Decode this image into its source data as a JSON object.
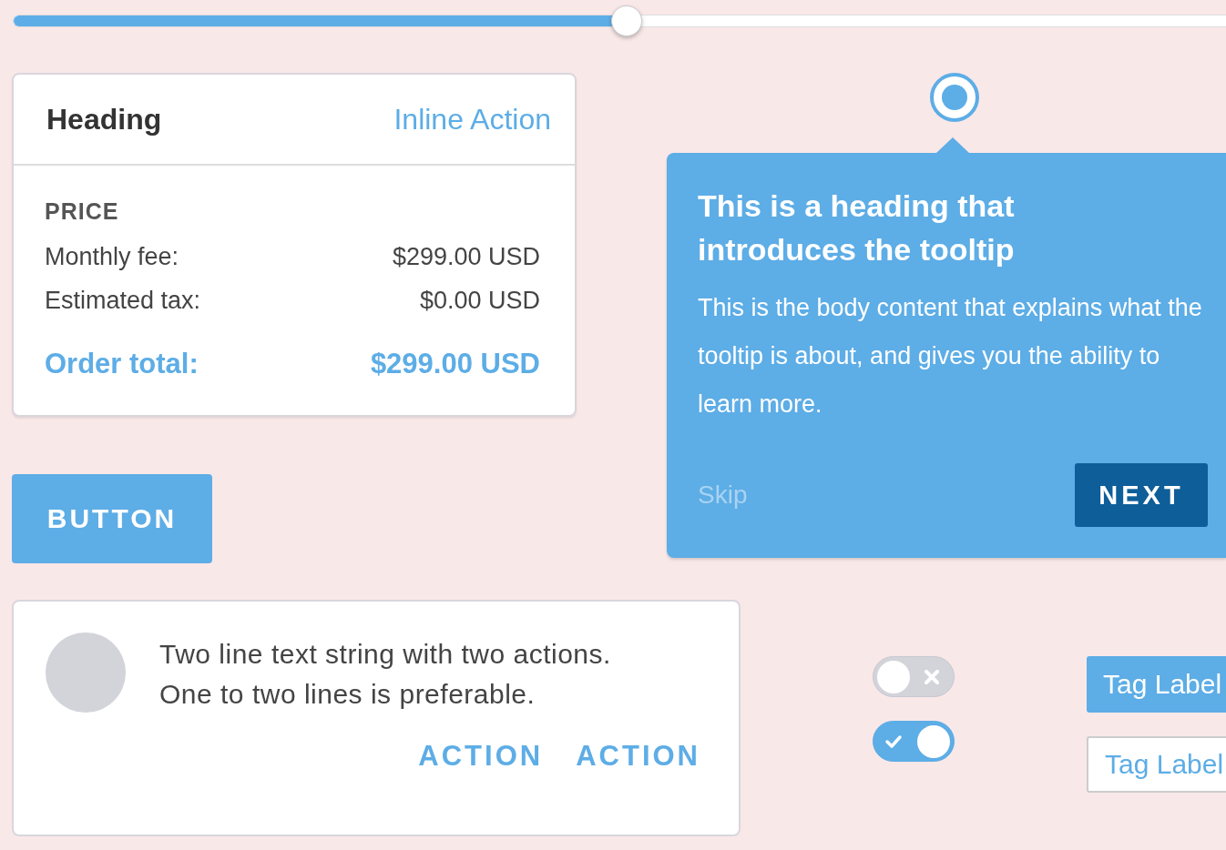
{
  "slider": {
    "level": 0.506
  },
  "price_card": {
    "heading": "Heading",
    "inline_action": "Inline Action",
    "section_label": "PRICE",
    "lines": [
      {
        "label": "Monthly fee:",
        "value": "$299.00 USD"
      },
      {
        "label": "Estimated tax:",
        "value": "$0.00 USD"
      }
    ],
    "total": {
      "label": "Order total:",
      "value": "$299.00 USD"
    }
  },
  "button": "BUTTON",
  "radio": {
    "selected": true
  },
  "tooltip": {
    "heading": "This is a heading that introduces the tooltip",
    "body": "This is the body content that explains what the tooltip is about, and gives you the ability to learn more.",
    "skip": "Skip",
    "next": "NEXT"
  },
  "list_item": {
    "lines": [
      "Two line text string with two actions.",
      "One to two lines is preferable."
    ],
    "actions": [
      "ACTION",
      "ACTION"
    ]
  },
  "toggles": [
    {
      "on": false
    },
    {
      "on": true
    }
  ],
  "tags": [
    {
      "label": "Tag Label",
      "kind": "filled"
    },
    {
      "label": "Tag Label",
      "kind": "outline"
    }
  ]
}
